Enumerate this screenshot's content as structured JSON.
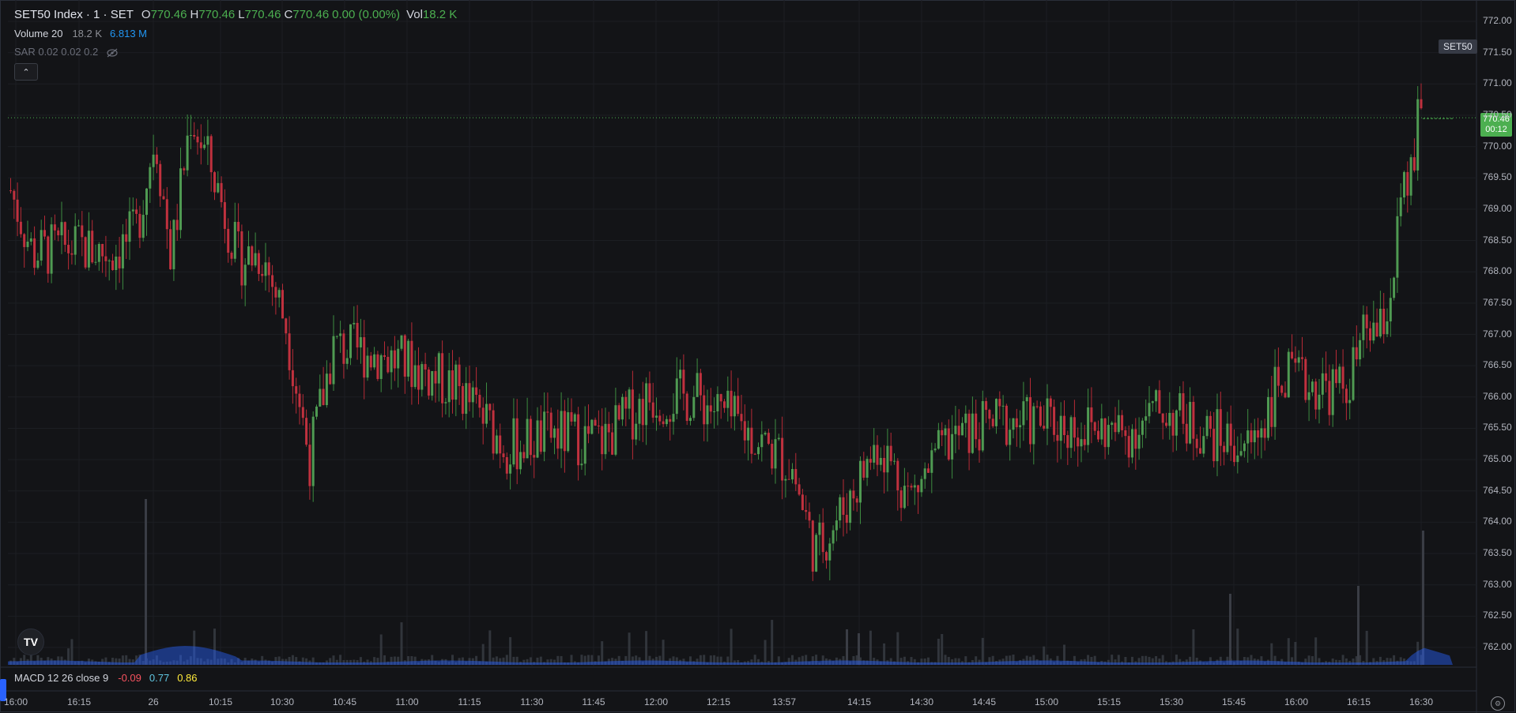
{
  "legend": {
    "symbol": "SET50 Index · 1 · SET",
    "open_k": "O",
    "open_v": "770.46",
    "high_k": "H",
    "high_v": "770.46",
    "low_k": "L",
    "low_v": "770.46",
    "close_k": "C",
    "close_v": "770.46",
    "change": "0.00 (0.00%)",
    "vol_k": "Vol",
    "vol_v": "18.2 K"
  },
  "volume_indicator": {
    "label": "Volume 20",
    "value1": "18.2 K",
    "value2": "6.813 M"
  },
  "sar_indicator": {
    "label": "SAR 0.02 0.02 0.2"
  },
  "macd_indicator": {
    "label": "MACD 12 26 close 9",
    "macd": "-0.09",
    "signal": "0.77",
    "hist": "0.86"
  },
  "tags": {
    "symbol": "SET50",
    "price": "770.46",
    "countdown": "00:12"
  },
  "logo_text": "TV",
  "icons": [
    "eye-off-icon",
    "chevron-up-icon",
    "tradingview-logo-icon",
    "settings-icon"
  ],
  "colors": {
    "up": "#4caf50",
    "down": "#f23645",
    "volume": "#2962ff",
    "background": "#131417"
  },
  "chart_data": {
    "type": "candlestick",
    "y_axis": {
      "range": [
        761.8,
        772.2
      ],
      "ticks": [
        "772.00",
        "771.50",
        "771.00",
        "770.50",
        "770.00",
        "769.50",
        "769.00",
        "768.50",
        "768.00",
        "767.50",
        "767.00",
        "766.50",
        "766.00",
        "765.50",
        "765.00",
        "764.50",
        "764.00",
        "763.50",
        "763.00",
        "762.50",
        "762.00"
      ]
    },
    "x_axis": {
      "ticks": [
        "16:00",
        "16:15",
        "26",
        "10:15",
        "10:30",
        "10:45",
        "11:00",
        "11:15",
        "11:30",
        "11:45",
        "12:00",
        "12:15",
        "13:57",
        "14:15",
        "14:30",
        "14:45",
        "15:00",
        "15:15",
        "15:30",
        "15:45",
        "16:00",
        "16:15",
        "16:30"
      ]
    },
    "last_price": 770.46,
    "key_levels": {
      "session_high": 771.3,
      "session_low": 762.8
    }
  }
}
